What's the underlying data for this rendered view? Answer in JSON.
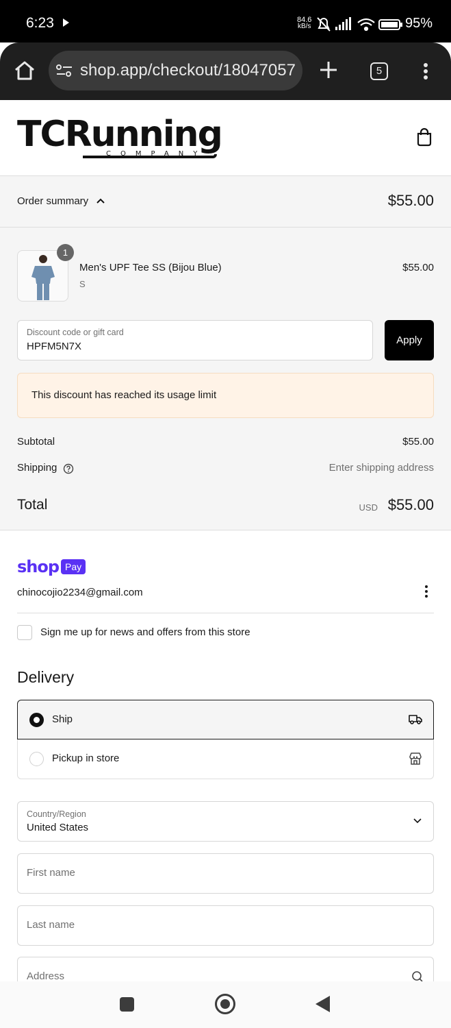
{
  "status_bar": {
    "time": "6:23",
    "net_rate_value": "84.6",
    "net_rate_unit": "kB/s",
    "battery": "95%"
  },
  "browser": {
    "url": "shop.app/checkout/18047057",
    "tab_count": "5"
  },
  "store": {
    "logo_text": "TCRunning",
    "logo_subtext": "COMPANY"
  },
  "order_summary": {
    "label": "Order summary",
    "total": "$55.00",
    "item": {
      "quantity": "1",
      "name": "Men's UPF Tee SS (Bijou Blue)",
      "variant": "S",
      "price": "$55.00"
    },
    "discount": {
      "label": "Discount code or gift card",
      "value": "HPFM5N7X",
      "apply_label": "Apply",
      "error": "This discount has reached its usage limit"
    },
    "subtotal_label": "Subtotal",
    "subtotal_value": "$55.00",
    "shipping_label": "Shipping",
    "shipping_value": "Enter shipping address",
    "total_label": "Total",
    "currency": "USD",
    "total_value": "$55.00"
  },
  "shop_pay": {
    "brand": "shop",
    "badge": "Pay",
    "email": "chinocojio2234@gmail.com",
    "newsletter_label": "Sign me up for news and offers from this store"
  },
  "delivery": {
    "title": "Delivery",
    "options": [
      {
        "label": "Ship",
        "selected": true,
        "icon": "truck-icon"
      },
      {
        "label": "Pickup in store",
        "selected": false,
        "icon": "store-icon"
      }
    ],
    "country_label": "Country/Region",
    "country_value": "United States",
    "first_name_placeholder": "First name",
    "last_name_placeholder": "Last name",
    "address_placeholder": "Address"
  },
  "colors": {
    "shop_pay_purple": "#5a31f4",
    "notice_bg": "#fff3e7",
    "button_black": "#000000"
  }
}
